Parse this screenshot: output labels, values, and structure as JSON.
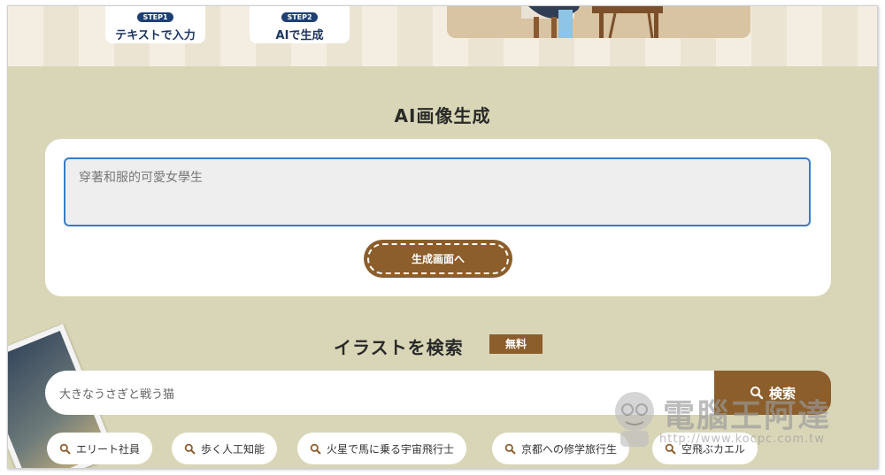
{
  "steps": [
    {
      "badge": "STEP1",
      "label": "テキストで入力"
    },
    {
      "badge": "STEP2",
      "label": "AIで生成"
    }
  ],
  "generator": {
    "title": "AI画像生成",
    "prompt_value": "穿著和服的可愛女學生",
    "button_label": "生成画面へ"
  },
  "search": {
    "title": "イラストを検索",
    "badge": "無料",
    "placeholder": "大きなうさぎと戦う猫",
    "button_label": "検索"
  },
  "tags": [
    "エリート社員",
    "歩く人工知能",
    "火星で馬に乗る宇宙飛行士",
    "京都への修学旅行生",
    "空飛ぶカエル"
  ],
  "watermark": {
    "name": "電腦王阿達",
    "url": "http://www.kocpc.com.tw"
  },
  "colors": {
    "background": "#d9d6b7",
    "accent_brown": "#8b5e2c",
    "step_badge": "#1d3f73",
    "input_border": "#3a7cc4"
  },
  "icons": {
    "tag_icon": "search-icon",
    "search_button_icon": "search-icon"
  }
}
